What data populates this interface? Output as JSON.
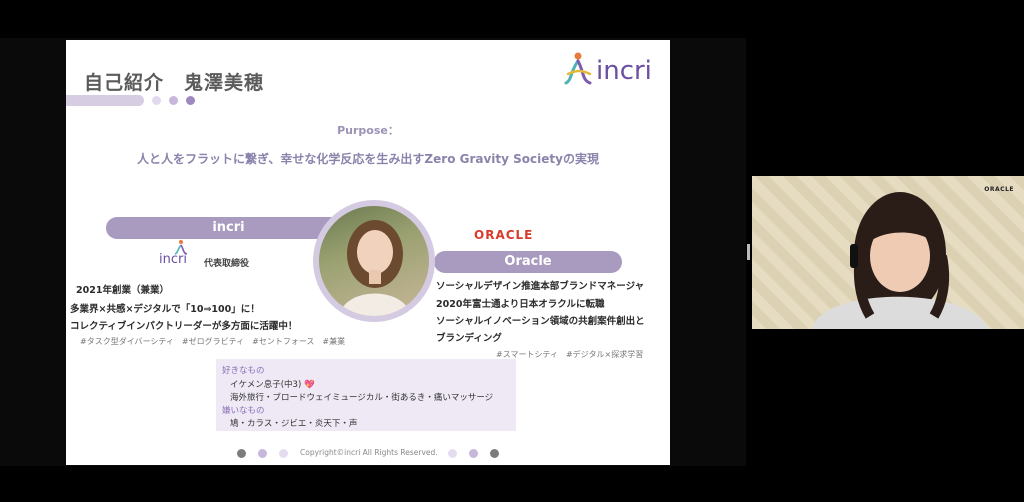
{
  "slide": {
    "title": "自己紹介　鬼澤美穂",
    "logo_text": "incri",
    "purpose_label": "Purpose：",
    "purpose_text": "人と人をフラットに繋ぎ、幸せな化学反応を生み出すZero Gravity Societyの実現",
    "left_bar_label": "incri",
    "right_bar_label": "Oracle",
    "oracle_logo": "ORACLE",
    "small_logo_text": "incri",
    "role": "代表取締役",
    "left_lines": [
      "2021年創業（兼業）",
      "多業界×共感×デジタルで「10⇒100」に！",
      "コレクティブインパクトリーダーが多方面に活躍中！"
    ],
    "left_tags": "#タスク型ダイバーシティ　#ゼログラビティ　#セントフォース　#兼業",
    "right_lines": [
      "ソーシャルデザイン推進本部ブランドマネージャ",
      "2020年富士通より日本オラクルに転職",
      "ソーシャルイノベーション領域の共創案件創出と",
      "ブランディング"
    ],
    "right_tags": "#スマートシティ　#デジタル×探求学習",
    "likes": {
      "likes_heading": "好きなもの",
      "likes_item1": "イケメン息子(中3) 💖",
      "likes_item2": "海外旅行・ブロードウェイミュージカル・街あるき・痛いマッサージ",
      "dislikes_heading": "嫌いなもの",
      "dislikes_item": "鳩・カラス・ジビエ・炎天下・声"
    },
    "copyright": "Copyright©incri All Rights Reserved."
  },
  "webcam": {
    "oracle_label": "ORACLE"
  },
  "colors": {
    "accent_purple": "#a99abf",
    "light_purple": "#d7cde3",
    "oracle_red": "#d83b2a"
  }
}
